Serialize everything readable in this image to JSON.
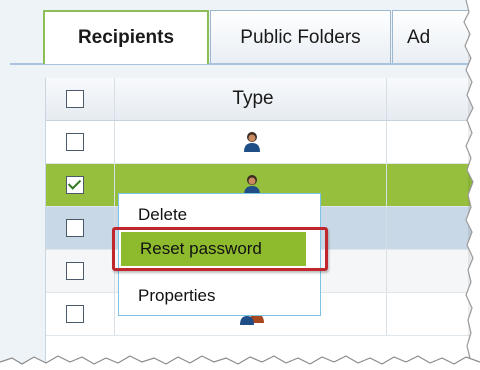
{
  "tabs": [
    {
      "label": "Recipients"
    },
    {
      "label": "Public Folders"
    },
    {
      "label": "Ad"
    }
  ],
  "grid": {
    "type_header": "Type",
    "rows": [
      {
        "checked": false,
        "icon": "user-icon"
      },
      {
        "checked": true,
        "icon": "user-icon",
        "state": "selected"
      },
      {
        "checked": false,
        "icon": "user-icon",
        "state": "hover"
      },
      {
        "checked": false,
        "icon": "user-icon"
      },
      {
        "checked": false,
        "icon": "group-icon"
      }
    ]
  },
  "context_menu": {
    "items": [
      {
        "label": "Delete"
      },
      {
        "label": "Reset password",
        "highlighted": true
      },
      {
        "label": "Properties"
      }
    ]
  },
  "colors": {
    "selected_row": "#95bf3c",
    "menu_highlight": "#8ebb2e",
    "callout_border": "#c0272d",
    "menu_border": "#7cc3e8"
  }
}
